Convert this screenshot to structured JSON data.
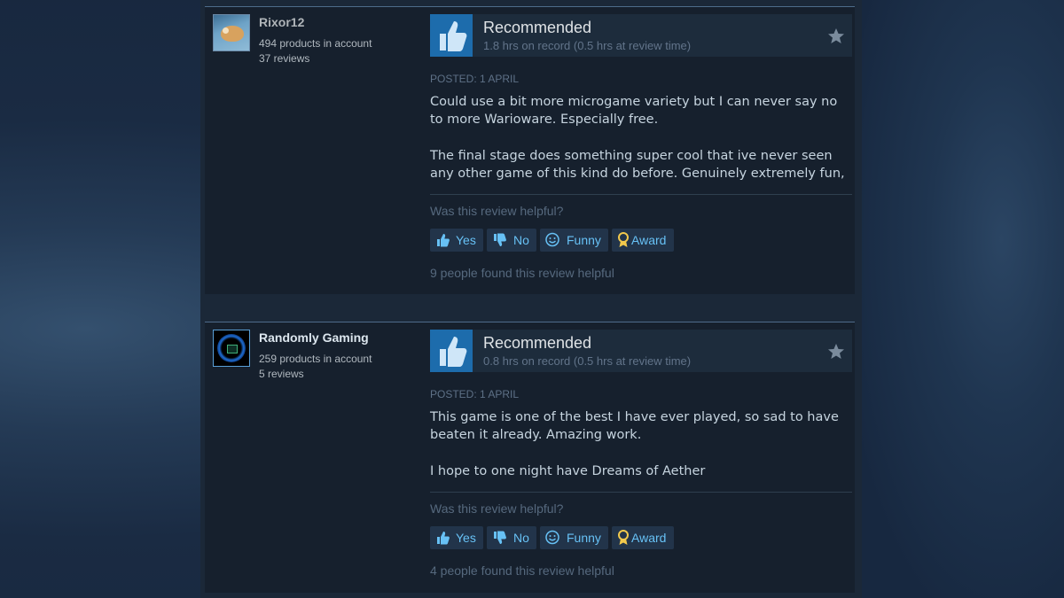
{
  "reviews": [
    {
      "author": "Rixor12",
      "products": "494 products in account",
      "reviews_count": "37 reviews",
      "verdict": "Recommended",
      "hours": "1.8 hrs on record (0.5 hrs at review time)",
      "posted": "Posted: 1 April",
      "paragraphs": [
        "Could use a bit more microgame variety but I can never say no to more Warioware. Especially free.",
        "The final stage does something super cool that ive never seen any other game of this kind do before. Genuinely extremely fun,"
      ],
      "helpful_question": "Was this review helpful?",
      "buttons": {
        "yes": "Yes",
        "no": "No",
        "funny": "Funny",
        "award": "Award"
      },
      "helpful_count": "9 people found this review helpful"
    },
    {
      "author": "Randomly Gaming",
      "products": "259 products in account",
      "reviews_count": "5 reviews",
      "verdict": "Recommended",
      "hours": "0.8 hrs on record (0.5 hrs at review time)",
      "posted": "Posted: 1 April",
      "paragraphs": [
        "This game is one of the best I have ever played, so sad to have beaten it already. Amazing work.",
        "I hope to one night have Dreams of Aether"
      ],
      "helpful_question": "Was this review helpful?",
      "buttons": {
        "yes": "Yes",
        "no": "No",
        "funny": "Funny",
        "award": "Award"
      },
      "helpful_count": "4 people found this review helpful"
    }
  ],
  "icons": {
    "thumb": "thumbs-up-icon",
    "star": "star-icon",
    "yes": "thumbs-up-icon",
    "no": "thumbs-down-icon",
    "funny": "smiley-icon",
    "award": "award-icon"
  },
  "colors": {
    "link": "#67c1f5",
    "review_bg": "#16202d",
    "thumb_bg": "#1d6cac",
    "award": "#f2c94c"
  }
}
